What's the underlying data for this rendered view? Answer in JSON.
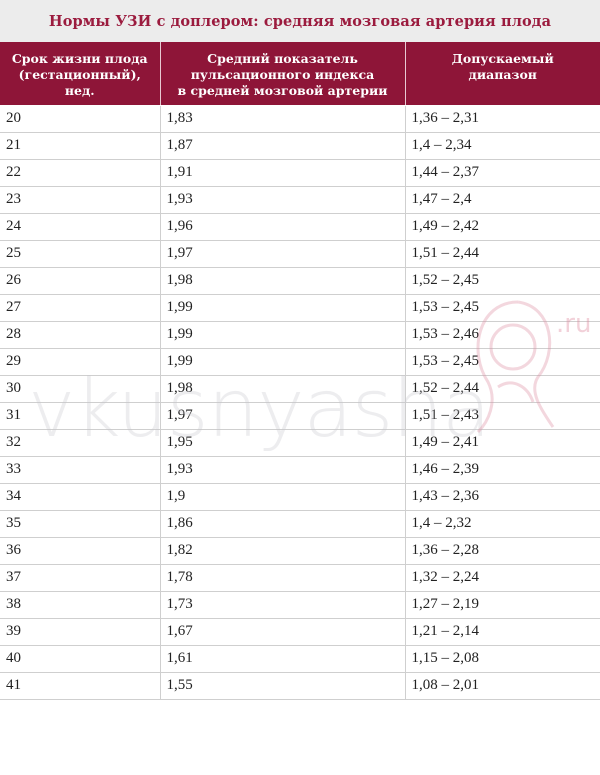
{
  "title": "Нормы УЗИ с доплером: средняя мозговая артерия плода",
  "table": {
    "headers": [
      "Срок жизни плода\n(гестационный), нед.",
      "Средний показатель\nпульсационного индекса\nв средней мозговой артерии",
      "Допускаемый\nдиапазон"
    ],
    "rows": [
      [
        "20",
        "1,83",
        "1,36 – 2,31"
      ],
      [
        "21",
        "1,87",
        "1,4 – 2,34"
      ],
      [
        "22",
        "1,91",
        "1,44 – 2,37"
      ],
      [
        "23",
        "1,93",
        "1,47 – 2,4"
      ],
      [
        "24",
        "1,96",
        "1,49 – 2,42"
      ],
      [
        "25",
        "1,97",
        "1,51 – 2,44"
      ],
      [
        "26",
        "1,98",
        "1,52 – 2,45"
      ],
      [
        "27",
        "1,99",
        "1,53 – 2,45"
      ],
      [
        "28",
        "1,99",
        "1,53 – 2,46"
      ],
      [
        "29",
        "1,99",
        "1,53 – 2,45"
      ],
      [
        "30",
        "1,98",
        "1,52 – 2,44"
      ],
      [
        "31",
        "1,97",
        "1,51 – 2,43"
      ],
      [
        "32",
        "1,95",
        "1,49 – 2,41"
      ],
      [
        "33",
        "1,93",
        "1,46 – 2,39"
      ],
      [
        "34",
        "1,9",
        "1,43 – 2,36"
      ],
      [
        "35",
        "1,86",
        "1,4 – 2,32"
      ],
      [
        "36",
        "1,82",
        "1,36 – 2,28"
      ],
      [
        "37",
        "1,78",
        "1,32 – 2,24"
      ],
      [
        "38",
        "1,73",
        "1,27 – 2,19"
      ],
      [
        "39",
        "1,67",
        "1,21 – 2,14"
      ],
      [
        "40",
        "1,61",
        "1,15 – 2,08"
      ],
      [
        "41",
        "1,55",
        "1,08 – 2,01"
      ]
    ]
  },
  "watermark": {
    "text": "vkusnyasha",
    "logo_suffix": ".ru"
  },
  "colors": {
    "header_bg": "#8e1538",
    "title_text": "#9b1b3e",
    "title_bar_bg": "#ececec"
  }
}
